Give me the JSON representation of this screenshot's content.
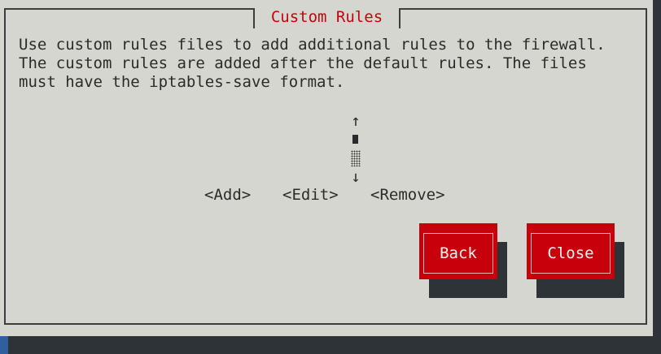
{
  "dialog": {
    "title": "Custom Rules",
    "description_lines": [
      "Use custom rules files to add additional rules to the firewall.",
      "The custom rules are added after the default rules. The files",
      "must have the iptables-save format."
    ]
  },
  "scrollbar": {
    "up_arrow": "↑",
    "down_arrow": "↓"
  },
  "actions": {
    "add": "<Add>",
    "edit": "<Edit>",
    "remove": "<Remove>"
  },
  "buttons": {
    "back": "Back",
    "close": "Close"
  },
  "colors": {
    "background": "#d6d6d0",
    "accent_red": "#c8000b",
    "shadow": "#2e3338",
    "text": "#2b2b2b"
  }
}
